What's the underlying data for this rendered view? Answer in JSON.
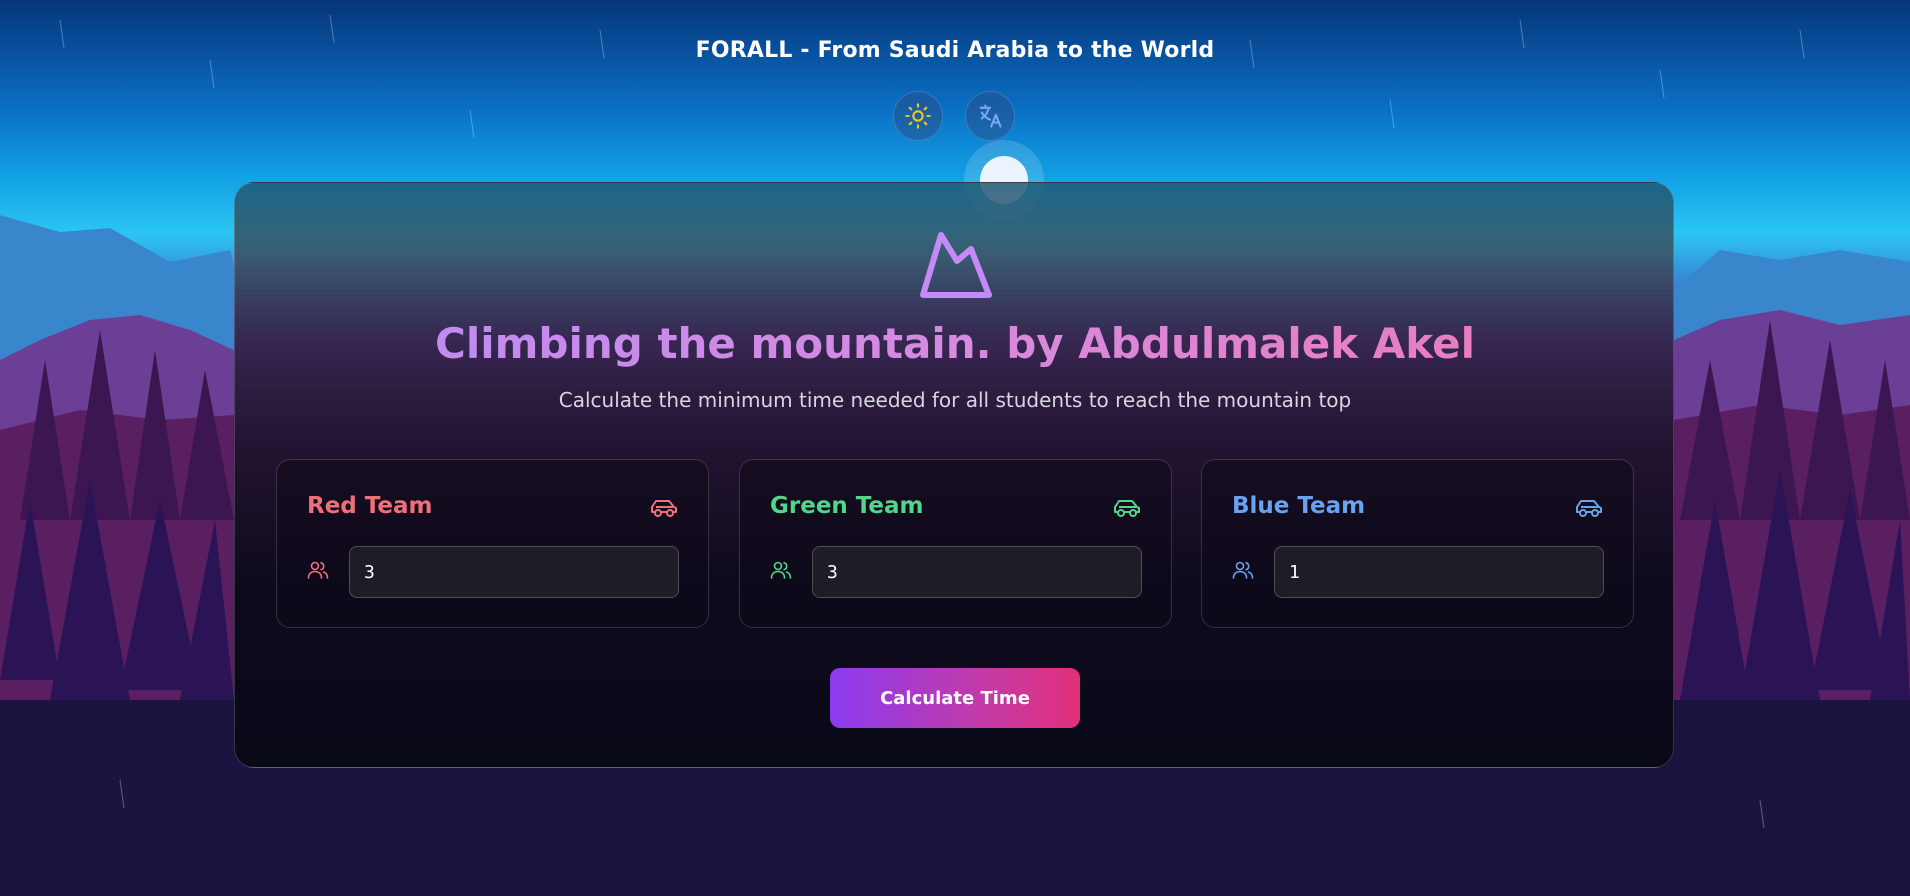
{
  "header": {
    "title": "FORALL - From Saudi Arabia to the World",
    "theme_toggle_icon": "sun-icon",
    "language_toggle_icon": "translate-icon"
  },
  "card": {
    "logo_icon": "mountain-icon",
    "title": "Climbing the mountain. by Abdulmalek Akel",
    "subtitle": "Calculate the minimum time needed for all students to reach the mountain top",
    "teams": [
      {
        "name": "Red Team",
        "value": "3",
        "color": "#f0707a",
        "icon": "car-icon",
        "input_icon": "users-icon"
      },
      {
        "name": "Green Team",
        "value": "3",
        "color": "#52d68a",
        "icon": "car-icon",
        "input_icon": "users-icon"
      },
      {
        "name": "Blue Team",
        "value": "1",
        "color": "#6aa2f2",
        "icon": "car-icon",
        "input_icon": "users-icon"
      }
    ],
    "calculate_label": "Calculate Time"
  },
  "colors": {
    "accent_start": "#8b3bf0",
    "accent_end": "#e22f7a",
    "title_start": "#b88cf5",
    "title_end": "#ef79b4",
    "sun": "#f5c518"
  }
}
